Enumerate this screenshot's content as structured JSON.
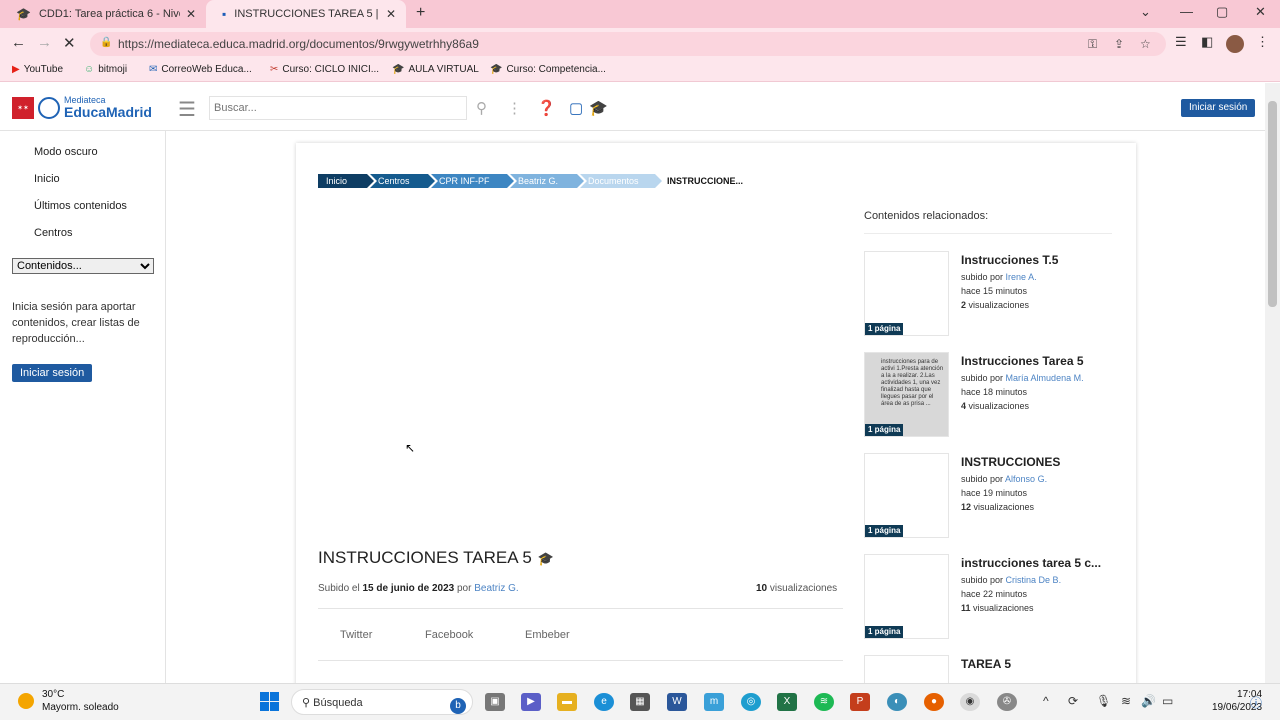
{
  "browser": {
    "tabs": [
      {
        "title": "CDD1: Tarea práctica 6 - Nivel A2",
        "close": "✕"
      },
      {
        "title": "INSTRUCCIONES TAREA 5 | Media",
        "close": "✕"
      }
    ],
    "new_tab": "+",
    "url": "https://mediateca.educa.madrid.org/documentos/9rwgywetrhhy86a9",
    "bookmarks": [
      {
        "label": "YouTube",
        "icon": "youtube-icon",
        "color": "#e62117"
      },
      {
        "label": "bitmoji",
        "icon": "bitmoji-icon",
        "color": "#3cb371"
      },
      {
        "label": "CorreoWeb Educa...",
        "icon": "mail-icon",
        "color": "#1f63b5"
      },
      {
        "label": "Curso: CICLO INICI...",
        "icon": "course-icon",
        "color": "#c0392b"
      },
      {
        "label": "AULA VIRTUAL",
        "icon": "graduation-cap-icon",
        "color": "#1f63b5"
      },
      {
        "label": "Curso: Competencia...",
        "icon": "graduation-cap-icon",
        "color": "#1f63b5"
      }
    ]
  },
  "header": {
    "logo_small": "Mediateca",
    "logo_big": "EducaMadrid",
    "search_placeholder": "Buscar...",
    "login": "Iniciar sesión"
  },
  "sidebar": {
    "items": [
      "Modo oscuro",
      "Inicio",
      "Últimos contenidos",
      "Centros"
    ],
    "select_value": "Contenidos...",
    "info": "Inicia sesión para aportar contenidos, crear listas de reproducción...",
    "login": "Iniciar sesión"
  },
  "breadcrumb": {
    "items": [
      {
        "label": "Inicio",
        "color": "#0e3d63"
      },
      {
        "label": "Centros",
        "color": "#155b8e"
      },
      {
        "label": "CPR INF-PF",
        "color": "#3d86c2"
      },
      {
        "label": "Beatriz G.",
        "color": "#7fb3de"
      },
      {
        "label": "Documentos",
        "color": "#b9d6ee"
      }
    ],
    "current": "INSTRUCCIONE..."
  },
  "related": {
    "heading": "Contenidos relacionados:",
    "subido_por": "subido por",
    "items": [
      {
        "title": "Instrucciones T.5",
        "user": "Irene A.",
        "time": "hace 15 minutos",
        "views": "2",
        "views_label": "visualizaciones",
        "badge": "1 página"
      },
      {
        "title": "Instrucciones Tarea 5",
        "user": "María Almudena M.",
        "time": "hace 18 minutos",
        "views": "4",
        "views_label": "visualizaciones",
        "badge": "1 página",
        "thumb_text": "instrucciones para de activi 1.Presta atención a la a realizar. 2.Las actividades 1, una vez finalizad hasta que llegues pasar por el área de as prisa ..."
      },
      {
        "title": "INSTRUCCIONES",
        "user": "Alfonso G.",
        "time": "hace 19 minutos",
        "views": "12",
        "views_label": "visualizaciones",
        "badge": "1 página"
      },
      {
        "title": "instrucciones tarea 5 c...",
        "user": "Cristina De B.",
        "time": "hace 22 minutos",
        "views": "11",
        "views_label": "visualizaciones",
        "badge": "1 página"
      },
      {
        "title": "TAREA 5"
      }
    ]
  },
  "document": {
    "title": "INSTRUCCIONES TAREA 5",
    "uploaded_prefix": "Subido el",
    "date": "15 de junio de 2023",
    "by": "por",
    "author": "Beatriz G.",
    "views": "10",
    "views_label": "visualizaciones",
    "share": [
      "Twitter",
      "Facebook",
      "Embeber"
    ]
  },
  "taskbar": {
    "temp": "30°C",
    "weather": "Mayorm. soleado",
    "search": "Búsqueda",
    "time": "17:04",
    "date": "19/06/2023"
  }
}
